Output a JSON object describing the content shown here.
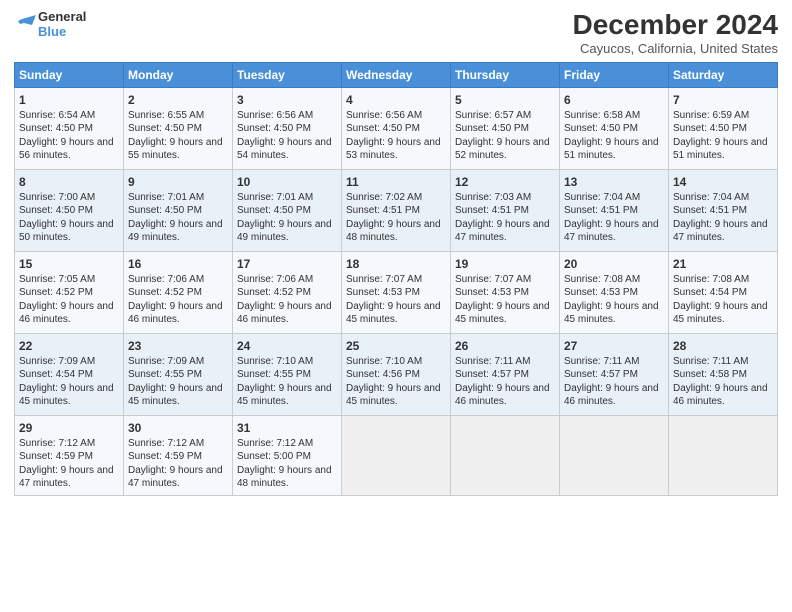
{
  "logo": {
    "line1": "General",
    "line2": "Blue"
  },
  "title": "December 2024",
  "subtitle": "Cayucos, California, United States",
  "headers": [
    "Sunday",
    "Monday",
    "Tuesday",
    "Wednesday",
    "Thursday",
    "Friday",
    "Saturday"
  ],
  "weeks": [
    [
      {
        "num": "1",
        "sunrise": "6:54 AM",
        "sunset": "4:50 PM",
        "daylight": "9 hours and 56 minutes."
      },
      {
        "num": "2",
        "sunrise": "6:55 AM",
        "sunset": "4:50 PM",
        "daylight": "9 hours and 55 minutes."
      },
      {
        "num": "3",
        "sunrise": "6:56 AM",
        "sunset": "4:50 PM",
        "daylight": "9 hours and 54 minutes."
      },
      {
        "num": "4",
        "sunrise": "6:56 AM",
        "sunset": "4:50 PM",
        "daylight": "9 hours and 53 minutes."
      },
      {
        "num": "5",
        "sunrise": "6:57 AM",
        "sunset": "4:50 PM",
        "daylight": "9 hours and 52 minutes."
      },
      {
        "num": "6",
        "sunrise": "6:58 AM",
        "sunset": "4:50 PM",
        "daylight": "9 hours and 51 minutes."
      },
      {
        "num": "7",
        "sunrise": "6:59 AM",
        "sunset": "4:50 PM",
        "daylight": "9 hours and 51 minutes."
      }
    ],
    [
      {
        "num": "8",
        "sunrise": "7:00 AM",
        "sunset": "4:50 PM",
        "daylight": "9 hours and 50 minutes."
      },
      {
        "num": "9",
        "sunrise": "7:01 AM",
        "sunset": "4:50 PM",
        "daylight": "9 hours and 49 minutes."
      },
      {
        "num": "10",
        "sunrise": "7:01 AM",
        "sunset": "4:50 PM",
        "daylight": "9 hours and 49 minutes."
      },
      {
        "num": "11",
        "sunrise": "7:02 AM",
        "sunset": "4:51 PM",
        "daylight": "9 hours and 48 minutes."
      },
      {
        "num": "12",
        "sunrise": "7:03 AM",
        "sunset": "4:51 PM",
        "daylight": "9 hours and 47 minutes."
      },
      {
        "num": "13",
        "sunrise": "7:04 AM",
        "sunset": "4:51 PM",
        "daylight": "9 hours and 47 minutes."
      },
      {
        "num": "14",
        "sunrise": "7:04 AM",
        "sunset": "4:51 PM",
        "daylight": "9 hours and 47 minutes."
      }
    ],
    [
      {
        "num": "15",
        "sunrise": "7:05 AM",
        "sunset": "4:52 PM",
        "daylight": "9 hours and 46 minutes."
      },
      {
        "num": "16",
        "sunrise": "7:06 AM",
        "sunset": "4:52 PM",
        "daylight": "9 hours and 46 minutes."
      },
      {
        "num": "17",
        "sunrise": "7:06 AM",
        "sunset": "4:52 PM",
        "daylight": "9 hours and 46 minutes."
      },
      {
        "num": "18",
        "sunrise": "7:07 AM",
        "sunset": "4:53 PM",
        "daylight": "9 hours and 45 minutes."
      },
      {
        "num": "19",
        "sunrise": "7:07 AM",
        "sunset": "4:53 PM",
        "daylight": "9 hours and 45 minutes."
      },
      {
        "num": "20",
        "sunrise": "7:08 AM",
        "sunset": "4:53 PM",
        "daylight": "9 hours and 45 minutes."
      },
      {
        "num": "21",
        "sunrise": "7:08 AM",
        "sunset": "4:54 PM",
        "daylight": "9 hours and 45 minutes."
      }
    ],
    [
      {
        "num": "22",
        "sunrise": "7:09 AM",
        "sunset": "4:54 PM",
        "daylight": "9 hours and 45 minutes."
      },
      {
        "num": "23",
        "sunrise": "7:09 AM",
        "sunset": "4:55 PM",
        "daylight": "9 hours and 45 minutes."
      },
      {
        "num": "24",
        "sunrise": "7:10 AM",
        "sunset": "4:55 PM",
        "daylight": "9 hours and 45 minutes."
      },
      {
        "num": "25",
        "sunrise": "7:10 AM",
        "sunset": "4:56 PM",
        "daylight": "9 hours and 45 minutes."
      },
      {
        "num": "26",
        "sunrise": "7:11 AM",
        "sunset": "4:57 PM",
        "daylight": "9 hours and 46 minutes."
      },
      {
        "num": "27",
        "sunrise": "7:11 AM",
        "sunset": "4:57 PM",
        "daylight": "9 hours and 46 minutes."
      },
      {
        "num": "28",
        "sunrise": "7:11 AM",
        "sunset": "4:58 PM",
        "daylight": "9 hours and 46 minutes."
      }
    ],
    [
      {
        "num": "29",
        "sunrise": "7:12 AM",
        "sunset": "4:59 PM",
        "daylight": "9 hours and 47 minutes."
      },
      {
        "num": "30",
        "sunrise": "7:12 AM",
        "sunset": "4:59 PM",
        "daylight": "9 hours and 47 minutes."
      },
      {
        "num": "31",
        "sunrise": "7:12 AM",
        "sunset": "5:00 PM",
        "daylight": "9 hours and 48 minutes."
      },
      null,
      null,
      null,
      null
    ]
  ]
}
